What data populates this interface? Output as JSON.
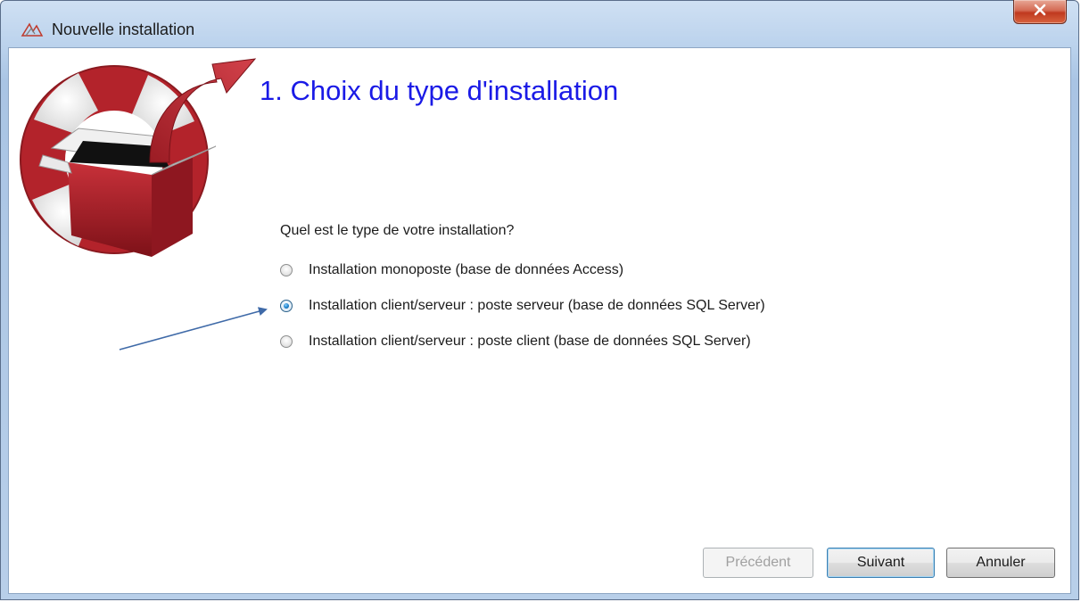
{
  "window": {
    "title": "Nouvelle installation",
    "icon": "installer-app-icon",
    "close_icon": "close-x-icon"
  },
  "wizard": {
    "step_title": "1. Choix du type d'installation",
    "question": "Quel est le type de votre installation?",
    "options": [
      {
        "label": "Installation monoposte (base de données Access)",
        "checked": false
      },
      {
        "label": "Installation client/serveur : poste serveur (base de données SQL Server)",
        "checked": true
      },
      {
        "label": "Installation client/serveur : poste client (base de données SQL Server)",
        "checked": false
      }
    ]
  },
  "buttons": {
    "previous": {
      "label": "Précédent",
      "enabled": false
    },
    "next": {
      "label": "Suivant",
      "enabled": true
    },
    "cancel": {
      "label": "Annuler",
      "enabled": true
    }
  },
  "colors": {
    "heading": "#1a1ae6",
    "annotation_arrow": "#3f6aa8",
    "logo_red": "#b3232b"
  }
}
